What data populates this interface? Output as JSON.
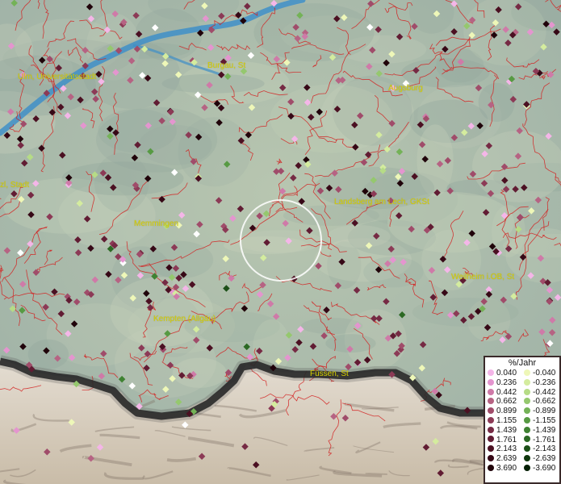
{
  "map": {
    "labels": [
      {
        "id": "ulm",
        "text": "Ulm, Universitätsstadt"
      },
      {
        "id": "burgau",
        "text": "Burgau, St"
      },
      {
        "id": "augsburg",
        "text": "Augsburg"
      },
      {
        "id": "stadt",
        "text": "zl, Stadt"
      },
      {
        "id": "landsberg",
        "text": "Landsberg am Lech, GKSt"
      },
      {
        "id": "memmingen",
        "text": "Memmingen"
      },
      {
        "id": "weilheim",
        "text": "Weilheim i.OB, St"
      },
      {
        "id": "kempten",
        "text": "Kempten (Allgäu)"
      },
      {
        "id": "fuessen",
        "text": "Füssen, St"
      }
    ],
    "colors": {
      "district_lines": "#d42020",
      "river": "#3f8fc8",
      "border": "#1a1a1a",
      "label": "#d8d000"
    }
  },
  "legend": {
    "title": "%/Jahr",
    "positive": [
      {
        "value": "0.040",
        "color": "#f4b6e8"
      },
      {
        "value": "0.236",
        "color": "#e495cf"
      },
      {
        "value": "0.442",
        "color": "#cf7aa8"
      },
      {
        "value": "0.662",
        "color": "#b66383"
      },
      {
        "value": "0.899",
        "color": "#a04c6a"
      },
      {
        "value": "1.155",
        "color": "#8c3a56"
      },
      {
        "value": "1.439",
        "color": "#762a44"
      },
      {
        "value": "1.761",
        "color": "#611c33"
      },
      {
        "value": "2.143",
        "color": "#4b1022"
      },
      {
        "value": "2.639",
        "color": "#360816"
      },
      {
        "value": "3.690",
        "color": "#20030a"
      }
    ],
    "negative": [
      {
        "value": "-0.040",
        "color": "#eef7b8"
      },
      {
        "value": "-0.236",
        "color": "#d4ec9e"
      },
      {
        "value": "-0.442",
        "color": "#b6dc86"
      },
      {
        "value": "-0.662",
        "color": "#95c86e"
      },
      {
        "value": "-0.899",
        "color": "#74b257"
      },
      {
        "value": "-1.155",
        "color": "#579a43"
      },
      {
        "value": "-1.439",
        "color": "#3f8232"
      },
      {
        "value": "-1.761",
        "color": "#2c6924"
      },
      {
        "value": "-2.143",
        "color": "#1c5018"
      },
      {
        "value": "-2.639",
        "color": "#0f370d"
      },
      {
        "value": "-3.690",
        "color": "#051f05"
      }
    ]
  }
}
